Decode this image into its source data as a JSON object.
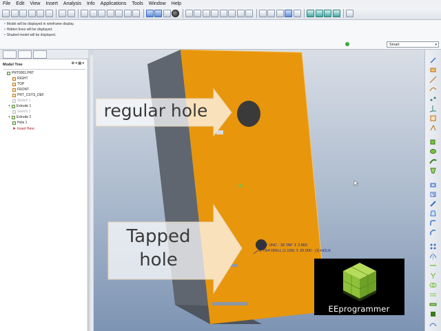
{
  "menu": {
    "items": [
      "File",
      "Edit",
      "View",
      "Insert",
      "Analysis",
      "Info",
      "Applications",
      "Tools",
      "Window",
      "Help"
    ]
  },
  "messages": [
    "Model will be displayed in wireframe display.",
    "Hidden lines will be displayed.",
    "Shaded model will be displayed."
  ],
  "filter": {
    "selected": "Smart"
  },
  "model_tree": {
    "title": "Model Tree",
    "items": [
      {
        "label": "PRT0001.PRT",
        "kind": "part"
      },
      {
        "label": "RIGHT",
        "kind": "plane"
      },
      {
        "label": "TOP",
        "kind": "plane"
      },
      {
        "label": "FRONT",
        "kind": "plane"
      },
      {
        "label": "PRT_CSYS_DEF",
        "kind": "plane"
      },
      {
        "label": "Sketch 1",
        "kind": "suppressed"
      },
      {
        "label": "Extrude 1",
        "kind": "feature"
      },
      {
        "label": "Sketch 2",
        "kind": "suppressed"
      },
      {
        "label": "Extrude 2",
        "kind": "feature"
      },
      {
        "label": "Hole 1",
        "kind": "feature"
      },
      {
        "label": "Insert Here",
        "kind": "insert"
      }
    ]
  },
  "callouts": {
    "regular": "regular hole",
    "tapped_line1": "Tapped",
    "tapped_line2": "hole"
  },
  "dimensions": {
    "line1": "1/4-7 UNC - 28 TAP ↧ 2.860",
    "line2": "⌀ 7/64 DRILL (1.109) ↧ 20.000 - (1) HOLE"
  },
  "logo": {
    "text": "EEprogrammer"
  },
  "colors": {
    "part_face": "#e8960c",
    "part_side": "#5f6670",
    "viewport_top": "#d9dee6",
    "viewport_bottom": "#7d94b3",
    "logo_cube": "#8fc23a"
  }
}
